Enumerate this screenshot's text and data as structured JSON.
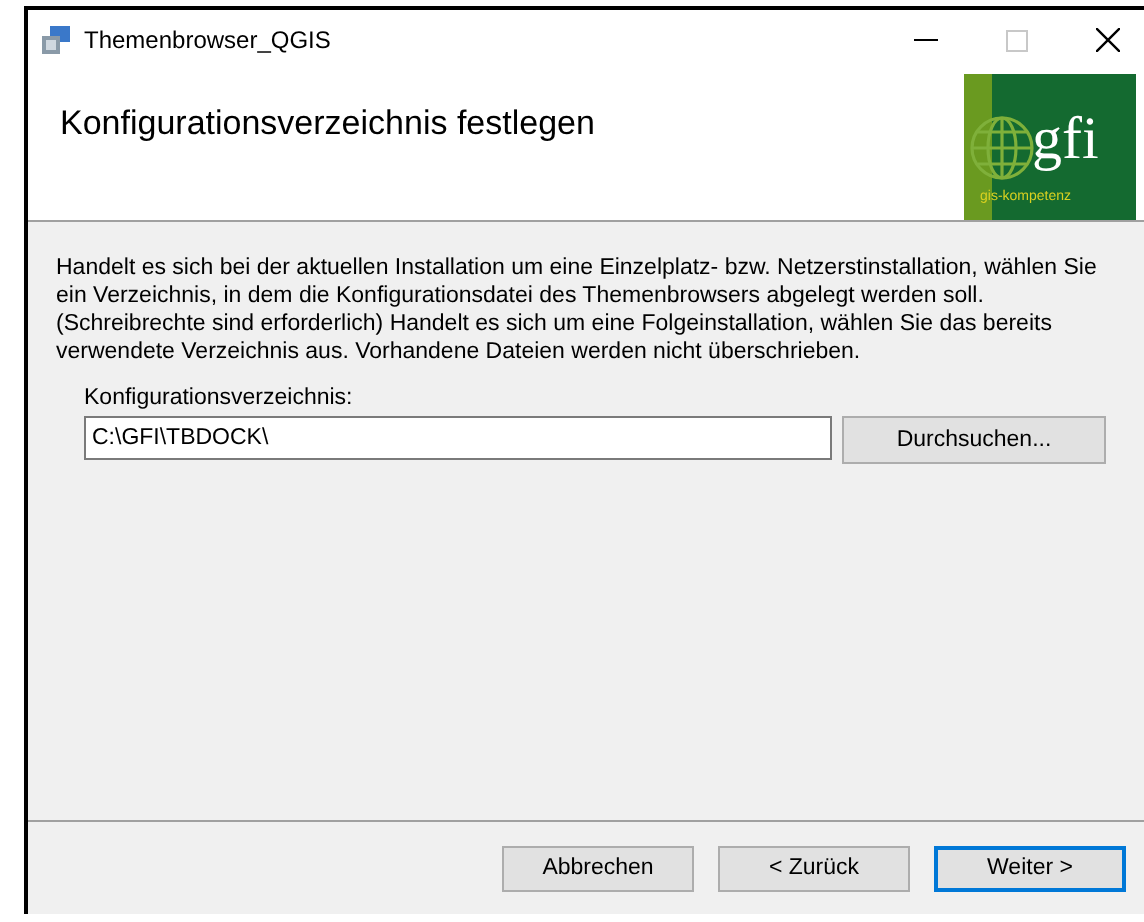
{
  "window": {
    "title": "Themenbrowser_QGIS"
  },
  "header": {
    "title": "Konfigurationsverzeichnis festlegen",
    "logo": {
      "name": "gfi",
      "tagline": "gis-kompetenz"
    }
  },
  "description": "Handelt es sich bei der aktuellen Installation um eine Einzelplatz- bzw. Netzerstinstallation, wählen Sie ein Verzeichnis, in dem die Konfigurationsdatei des Themenbrowsers abgelegt werden soll. (Schreibrechte sind erforderlich)  Handelt es sich um eine Folgeinstallation, wählen Sie das bereits verwendete Verzeichnis aus. Vorhandene Dateien werden nicht überschrieben.",
  "field": {
    "label": "Konfigurationsverzeichnis:",
    "value": "C:\\GFI\\TBDOCK\\",
    "button": "Durchsuchen..."
  },
  "buttons": [
    {
      "label": "Abbrechen",
      "default": false
    },
    {
      "label": "< Zurück",
      "default": false
    },
    {
      "label": "Weiter >",
      "default": true
    }
  ]
}
